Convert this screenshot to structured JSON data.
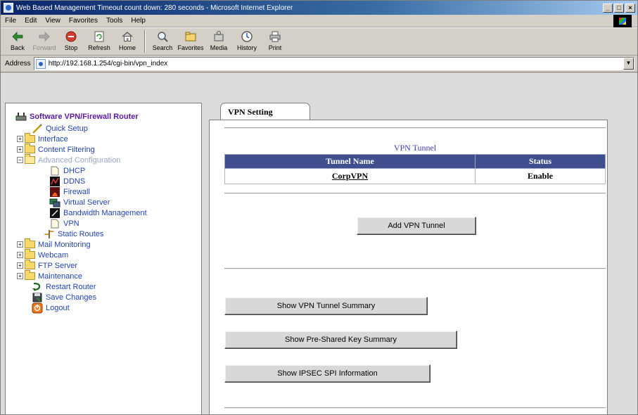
{
  "window": {
    "title": "Web Based Management Timeout count down: 280 seconds - Microsoft Internet Explorer",
    "controls": [
      "_",
      "□",
      "×"
    ]
  },
  "menu": [
    "File",
    "Edit",
    "View",
    "Favorites",
    "Tools",
    "Help"
  ],
  "toolbar": {
    "back": "Back",
    "forward": "Forward",
    "stop": "Stop",
    "refresh": "Refresh",
    "home": "Home",
    "search": "Search",
    "favorites": "Favorites",
    "media": "Media",
    "history": "History",
    "print": "Print"
  },
  "address": {
    "label": "Address",
    "url": "http://192.168.1.254/cgi-bin/vpn_index"
  },
  "sidebar": {
    "root": "Software VPN/Firewall Router",
    "items": [
      {
        "label": "Quick Setup"
      },
      {
        "label": "Interface"
      },
      {
        "label": "Content Filtering"
      },
      {
        "label": "Advanced Configuration"
      },
      {
        "label": "DHCP"
      },
      {
        "label": "DDNS"
      },
      {
        "label": "Firewall"
      },
      {
        "label": "Virtual Server"
      },
      {
        "label": "Bandwidth Management"
      },
      {
        "label": "VPN"
      },
      {
        "label": "Static Routes"
      },
      {
        "label": "Mail Monitoring"
      },
      {
        "label": "Webcam"
      },
      {
        "label": "FTP Server"
      },
      {
        "label": "Maintenance"
      },
      {
        "label": "Restart Router"
      },
      {
        "label": "Save Changes"
      },
      {
        "label": "Logout"
      }
    ]
  },
  "main": {
    "tab": "VPN Setting",
    "section_title": "VPN Tunnel",
    "table": {
      "headers": [
        "Tunnel Name",
        "Status"
      ],
      "rows": [
        {
          "name": "CorpVPN",
          "status": "Enable"
        }
      ]
    },
    "buttons": {
      "add_tunnel": "Add VPN Tunnel",
      "show_summary": "Show VPN Tunnel Summary",
      "show_psk": "Show Pre-Shared Key Summary",
      "show_ipsec": "Show IPSEC SPI Information"
    }
  }
}
